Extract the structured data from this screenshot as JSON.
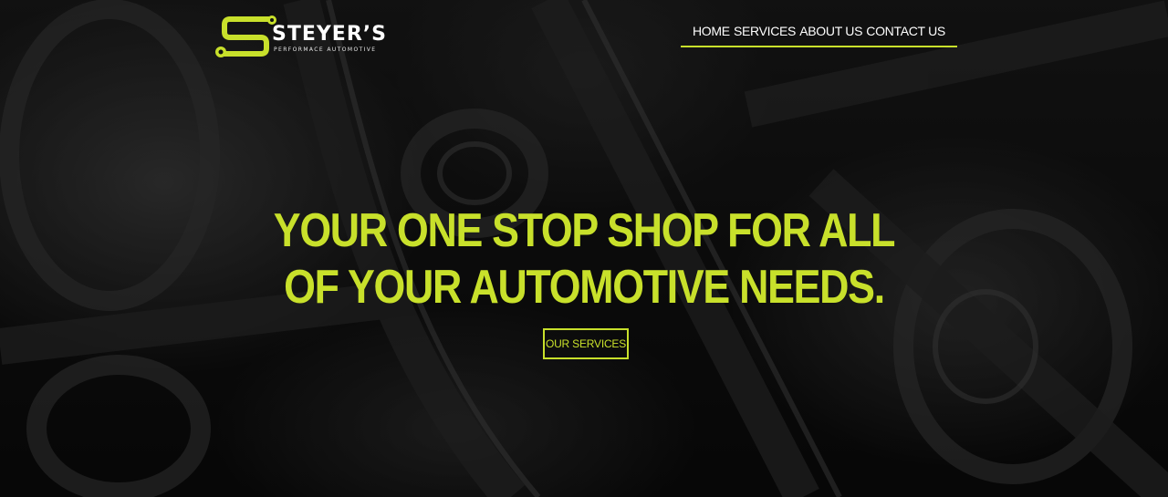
{
  "brand": {
    "name": "STEYER’S",
    "tagline": "PERFORMACE AUTOMOTIVE",
    "logo_icon": "wrench-s-icon",
    "accent_color": "#c8e02b"
  },
  "nav": {
    "items": [
      {
        "label": "HOME"
      },
      {
        "label": "SERVICES"
      },
      {
        "label": "ABOUT US"
      },
      {
        "label": "CONTACT US"
      }
    ]
  },
  "hero": {
    "title": "YOUR ONE STOP SHOP FOR ALL OF YOUR AUTOMOTIVE NEEDS.",
    "cta_label": "OUR SERVICES",
    "background": "dark engine parts photo"
  }
}
